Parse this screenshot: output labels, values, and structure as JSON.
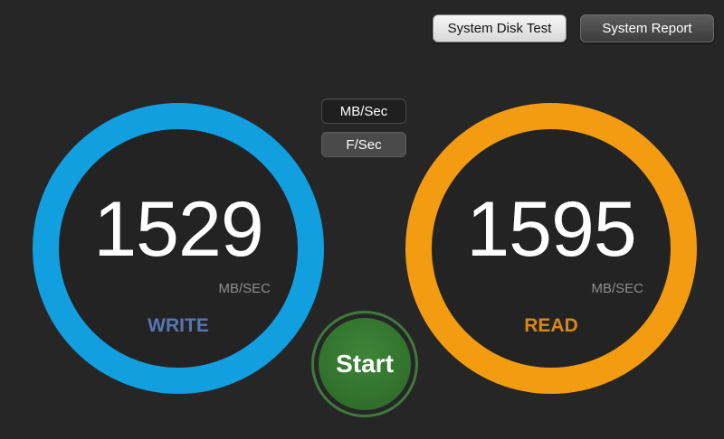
{
  "toolbar": {
    "system_disk_test_label": "System Disk Test",
    "system_report_label": "System Report"
  },
  "units_toggle": {
    "mbsec_label": "MB/Sec",
    "fsec_label": "F/Sec",
    "selected": "F/Sec"
  },
  "write": {
    "value": "1529",
    "unit": "MB/SEC",
    "label": "WRITE",
    "ring_color": "#119fe0",
    "label_color": "#5875b3"
  },
  "read": {
    "value": "1595",
    "unit": "MB/SEC",
    "label": "READ",
    "ring_color": "#f39c12",
    "label_color": "#d68718"
  },
  "start": {
    "label": "Start",
    "color": "#31702c"
  }
}
